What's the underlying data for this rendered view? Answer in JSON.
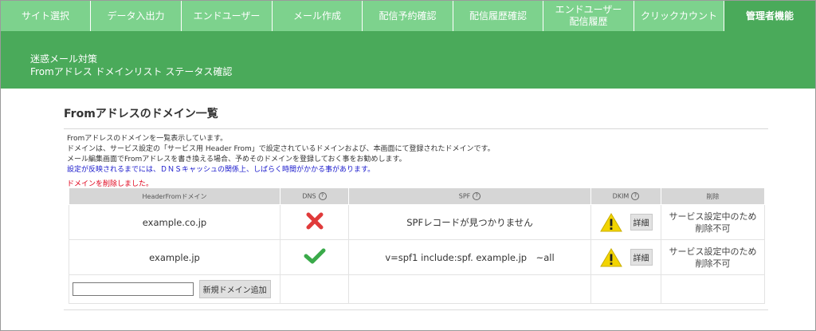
{
  "nav": {
    "tabs": [
      {
        "label": "サイト選択",
        "active": false
      },
      {
        "label": "データ入出力",
        "active": false
      },
      {
        "label": "エンドユーザー",
        "active": false
      },
      {
        "label": "メール作成",
        "active": false
      },
      {
        "label": "配信予約確認",
        "active": false
      },
      {
        "label": "配信履歴確認",
        "active": false
      },
      {
        "label": "エンドユーザー\n配信履歴",
        "active": false
      },
      {
        "label": "クリックカウント",
        "active": false
      },
      {
        "label": "管理者機能",
        "active": true
      }
    ]
  },
  "banner": {
    "line1": "迷惑メール対策",
    "line2": "Fromアドレス ドメインリスト ステータス確認"
  },
  "section": {
    "title": "Fromアドレスのドメイン一覧",
    "desc": [
      "Fromアドレスのドメインを一覧表示しています。",
      "ドメインは、サービス設定の「サービス用 Header From」で設定されているドメインおよび、本画面にて登録されたドメインです。",
      "メール編集画面でFromアドレスを書き換える場合、予めそのドメインを登録しておく事をお勧めします。",
      "設定が反映されるまでには、ＤＮＳキャッシュの関係上、しばらく時間がかかる事があります。"
    ],
    "deleted_message": "ドメインを削除しました。"
  },
  "table": {
    "headers": {
      "domain": "HeaderFromドメイン",
      "dns": "DNS",
      "spf": "SPF",
      "dkim": "DKIM",
      "delete": "削除"
    },
    "help_glyph": "?",
    "rows": [
      {
        "domain": "example.co.jp",
        "dns_status": "error",
        "spf": "SPFレコードが見つかりません",
        "dkim_status": "warning",
        "detail_label": "詳細",
        "delete_text": "サービス設定中のため\n削除不可"
      },
      {
        "domain": "example.jp",
        "dns_status": "ok",
        "spf": "v=spf1 include:spf. example.jp　~all",
        "dkim_status": "warning",
        "detail_label": "詳細",
        "delete_text": "サービス設定中のため\n削除不可"
      }
    ],
    "new_domain": {
      "value": "",
      "placeholder": "",
      "add_label": "新規ドメイン追加"
    }
  },
  "colors": {
    "nav_bg": "#7dd28d",
    "active_bg": "#4aaa5a",
    "error": "#e03a3a",
    "ok": "#3aaa4a",
    "warning": "#f2d400"
  }
}
